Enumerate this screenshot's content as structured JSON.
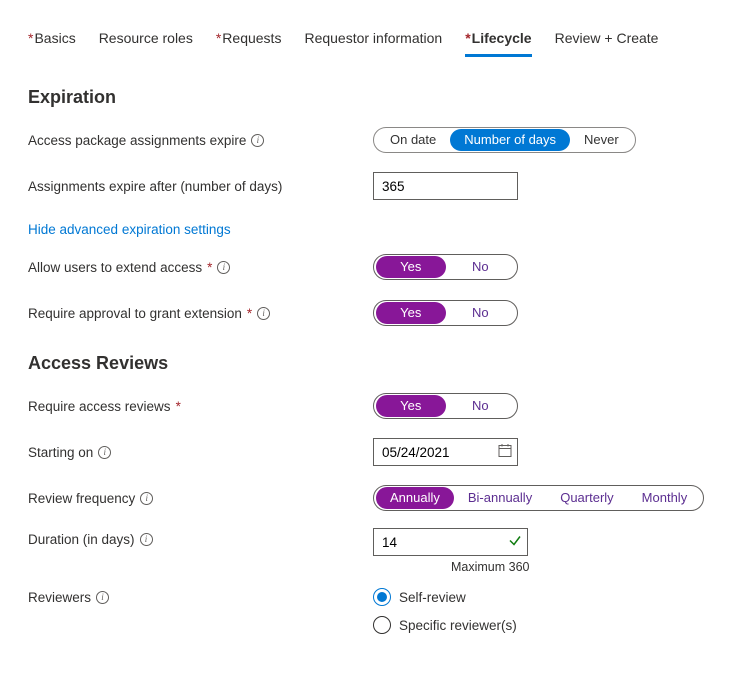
{
  "tabs": [
    {
      "label": "Basics",
      "required": true,
      "active": false
    },
    {
      "label": "Resource roles",
      "required": false,
      "active": false
    },
    {
      "label": "Requests",
      "required": true,
      "active": false
    },
    {
      "label": "Requestor information",
      "required": false,
      "active": false
    },
    {
      "label": "Lifecycle",
      "required": true,
      "active": true
    },
    {
      "label": "Review + Create",
      "required": false,
      "active": false
    }
  ],
  "expiration": {
    "heading": "Expiration",
    "expire_mode": {
      "label": "Access package assignments expire",
      "options": [
        "On date",
        "Number of days",
        "Never"
      ],
      "selected": "Number of days"
    },
    "expire_after": {
      "label": "Assignments expire after (number of days)",
      "value": "365"
    },
    "advanced_link": "Hide advanced expiration settings",
    "allow_extend": {
      "label": "Allow users to extend access",
      "options": [
        "Yes",
        "No"
      ],
      "selected": "Yes"
    },
    "require_approval_ext": {
      "label": "Require approval to grant extension",
      "options": [
        "Yes",
        "No"
      ],
      "selected": "Yes"
    }
  },
  "reviews": {
    "heading": "Access Reviews",
    "require_reviews": {
      "label": "Require access reviews",
      "options": [
        "Yes",
        "No"
      ],
      "selected": "Yes"
    },
    "starting_on": {
      "label": "Starting on",
      "value": "05/24/2021"
    },
    "frequency": {
      "label": "Review frequency",
      "options": [
        "Annually",
        "Bi-annually",
        "Quarterly",
        "Monthly"
      ],
      "selected": "Annually"
    },
    "duration": {
      "label": "Duration (in days)",
      "value": "14",
      "helper": "Maximum 360"
    },
    "reviewers": {
      "label": "Reviewers",
      "options": [
        "Self-review",
        "Specific reviewer(s)"
      ],
      "selected": "Self-review"
    }
  }
}
